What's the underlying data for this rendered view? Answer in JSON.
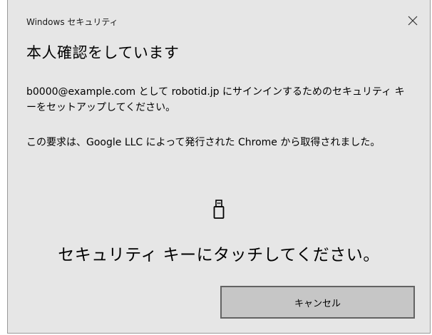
{
  "window": {
    "title": "Windows セキュリティ",
    "close_icon": "close-icon"
  },
  "dialog": {
    "heading": "本人確認をしています",
    "message_setup": "b0000@example.com として robotid.jp にサインインするためのセキュリティ キーをセットアップしてください。",
    "message_origin": "この要求は、Google LLC によって発行された Chrome から取得されました。",
    "key_icon": "usb-security-key-icon",
    "instruction": "セキュリティ キーにタッチしてください。",
    "cancel_label": "キャンセル"
  },
  "colors": {
    "dialog_background": "#e6e6e6",
    "button_background": "#c6c6c6",
    "button_border": "#636363"
  }
}
